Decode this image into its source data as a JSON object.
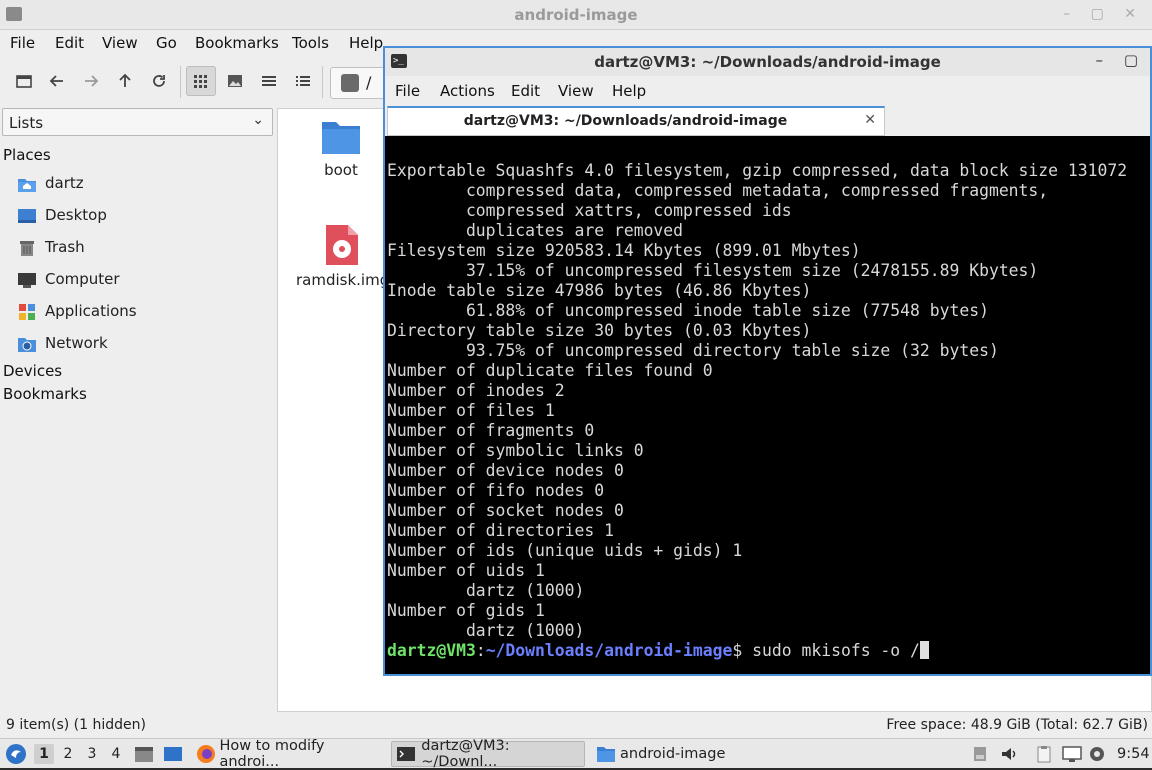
{
  "file_manager": {
    "title": "android-image",
    "window_buttons": "– ▢ ✕",
    "menu": [
      "File",
      "Edit",
      "View",
      "Go",
      "Bookmarks",
      "Tools",
      "Help"
    ],
    "toolbar_icons": [
      "new-tab-icon",
      "back-icon",
      "forward-icon",
      "up-icon",
      "reload-icon",
      "icon-view-icon",
      "thumbnail-view-icon",
      "compact-view-icon",
      "detail-view-icon"
    ],
    "path_text": "/",
    "side_panel_mode": "Lists",
    "sections": {
      "places": "Places",
      "devices": "Devices",
      "bookmarks": "Bookmarks"
    },
    "places": [
      {
        "label": "dartz",
        "icon": "home-folder-icon"
      },
      {
        "label": "Desktop",
        "icon": "desktop-icon"
      },
      {
        "label": "Trash",
        "icon": "trash-icon"
      },
      {
        "label": "Computer",
        "icon": "computer-icon"
      },
      {
        "label": "Applications",
        "icon": "applications-icon"
      },
      {
        "label": "Network",
        "icon": "network-icon"
      }
    ],
    "files": [
      {
        "name": "boot",
        "icon": "folder-icon"
      },
      {
        "name": "ramdisk.img",
        "icon": "disk-image-icon"
      }
    ],
    "status_left": "9 item(s) (1 hidden)",
    "status_right": "Free space: 48.9 GiB (Total: 62.7 GiB)"
  },
  "terminal": {
    "title": "dartz@VM3: ~/Downloads/android-image",
    "window_buttons": "– ▢",
    "menu": [
      "File",
      "Actions",
      "Edit",
      "View",
      "Help"
    ],
    "tab_title": "dartz@VM3: ~/Downloads/android-image",
    "tab_close": "✕",
    "output": [
      "Exportable Squashfs 4.0 filesystem, gzip compressed, data block size 131072",
      "        compressed data, compressed metadata, compressed fragments,",
      "        compressed xattrs, compressed ids",
      "        duplicates are removed",
      "Filesystem size 920583.14 Kbytes (899.01 Mbytes)",
      "        37.15% of uncompressed filesystem size (2478155.89 Kbytes)",
      "Inode table size 47986 bytes (46.86 Kbytes)",
      "        61.88% of uncompressed inode table size (77548 bytes)",
      "Directory table size 30 bytes (0.03 Kbytes)",
      "        93.75% of uncompressed directory table size (32 bytes)",
      "Number of duplicate files found 0",
      "Number of inodes 2",
      "Number of files 1",
      "Number of fragments 0",
      "Number of symbolic links 0",
      "Number of device nodes 0",
      "Number of fifo nodes 0",
      "Number of socket nodes 0",
      "Number of directories 1",
      "Number of ids (unique uids + gids) 1",
      "Number of uids 1",
      "        dartz (1000)",
      "Number of gids 1",
      "        dartz (1000)"
    ],
    "prompt_user": "dartz@VM3",
    "prompt_sep": ":",
    "prompt_path": "~/Downloads/android-image",
    "prompt_end": "$ ",
    "command": "sudo mkisofs -o /"
  },
  "taskbar": {
    "workspaces": [
      "1",
      "2",
      "3",
      "4"
    ],
    "tasks": [
      {
        "label": "How to modify androi...",
        "icon": "firefox-icon"
      },
      {
        "label": "dartz@VM3: ~/Downl...",
        "icon": "terminal-icon"
      },
      {
        "label": "android-image",
        "icon": "folder-icon"
      }
    ],
    "clock": "9:54"
  }
}
